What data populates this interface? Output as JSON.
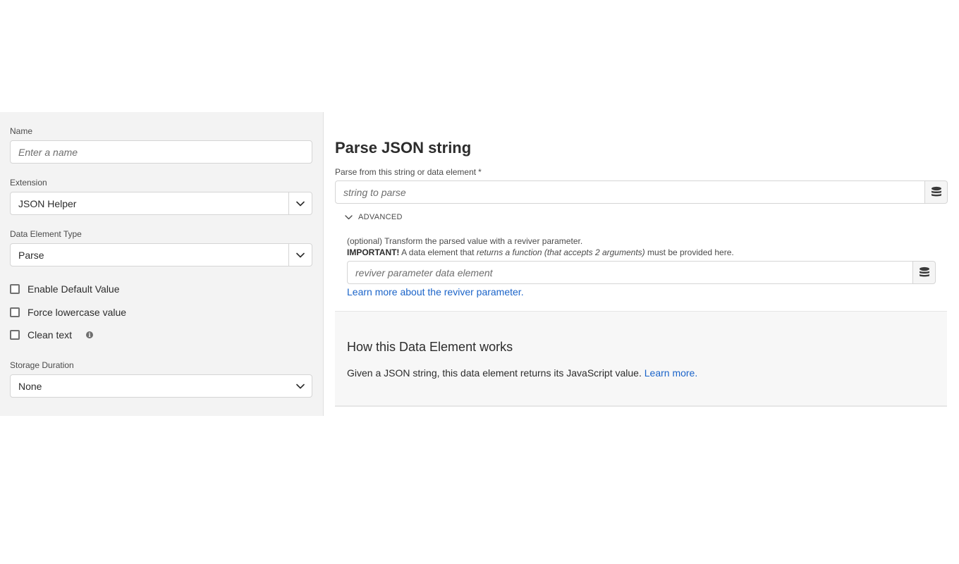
{
  "form": {
    "name": {
      "label": "Name",
      "placeholder": "Enter a name",
      "value": ""
    },
    "extension": {
      "label": "Extension",
      "value": "JSON Helper"
    },
    "data_element_type": {
      "label": "Data Element Type",
      "value": "Parse"
    },
    "checkboxes": [
      {
        "label": "Enable Default Value",
        "checked": false
      },
      {
        "label": "Force lowercase value",
        "checked": false
      },
      {
        "label": "Clean text",
        "checked": false
      }
    ],
    "storage_duration": {
      "label": "Storage Duration",
      "value": "None"
    }
  },
  "config": {
    "title": "Parse JSON string",
    "parse_field": {
      "label": "Parse from this string or data element",
      "required_mark": "*",
      "placeholder": "string to parse"
    },
    "advanced_label": "ADVANCED",
    "reviver_help_1": "(optional) Transform the parsed value with a reviver parameter.",
    "reviver_help_2_bold": "IMPORTANT!",
    "reviver_help_2_a": " A data element that ",
    "reviver_help_2_italic": "returns a function (that accepts 2 arguments)",
    "reviver_help_2_b": " must be provided here.",
    "reviver_field": {
      "placeholder": "reviver parameter data element"
    },
    "reviver_link": "Learn more about the reviver parameter."
  },
  "info_card": {
    "title": "How this Data Element works",
    "body": "Given a JSON string, this data element returns its JavaScript value.",
    "link": "Learn more."
  },
  "icons": {
    "dropdown": "chevron-down-icon",
    "data_element": "database-icon",
    "info": "info-icon",
    "advanced": "chevron-down-icon"
  },
  "colors": {
    "link": "#1b64c9",
    "left_panel_bg": "#f3f3f3"
  }
}
